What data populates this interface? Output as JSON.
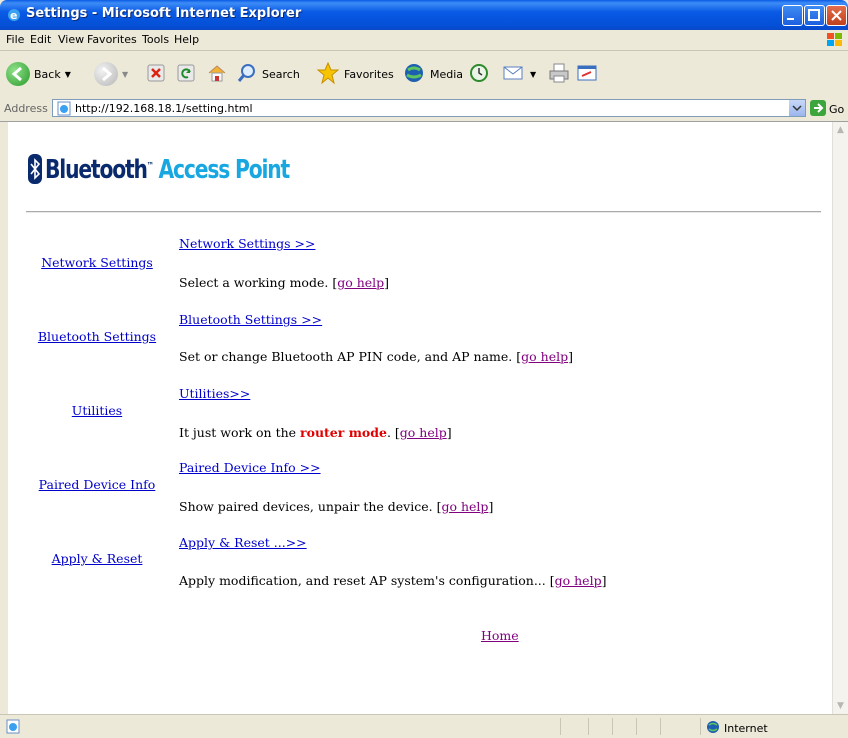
{
  "window": {
    "title": "Settings - Microsoft Internet Explorer"
  },
  "menu": {
    "items": [
      "File",
      "Edit",
      "View",
      "Favorites",
      "Tools",
      "Help"
    ]
  },
  "toolbar": {
    "back": "Back",
    "search": "Search",
    "favorites": "Favorites",
    "media": "Media"
  },
  "address": {
    "label": "Address",
    "url": "http://192.168.18.1/setting.html",
    "go": "Go"
  },
  "logo": {
    "brand": "Bluetooth",
    "tm": "™",
    "product": "Access Point"
  },
  "nav": {
    "network": "Network Settings",
    "bluetooth": "Bluetooth Settings",
    "utilities": "Utilities",
    "paired": "Paired Device Info",
    "apply": "Apply & Reset"
  },
  "sections": [
    {
      "title": "Network Settings >>",
      "desc": "Select a working mode. ",
      "help": "go help"
    },
    {
      "title": "Bluetooth Settings >>",
      "desc": "Set or change Bluetooth AP PIN code, and AP name. ",
      "help": "go help"
    },
    {
      "title": "Utilities>>",
      "desc_pre": "It just work on the ",
      "desc_bold": "router mode",
      "desc_post": ". ",
      "help": "go help"
    },
    {
      "title": "Paired Device Info >>",
      "desc": "Show paired devices, unpair the device. ",
      "help": "go help"
    },
    {
      "title": "Apply & Reset ...>>",
      "desc": "Apply modification, and reset AP system's configuration... ",
      "help": "go help"
    }
  ],
  "home": "Home",
  "status": {
    "zone": "Internet"
  },
  "colors": {
    "link": "#0000cc",
    "visited": "#800080",
    "accent_red": "#e00000",
    "titlebar": "#0a5ae6"
  }
}
